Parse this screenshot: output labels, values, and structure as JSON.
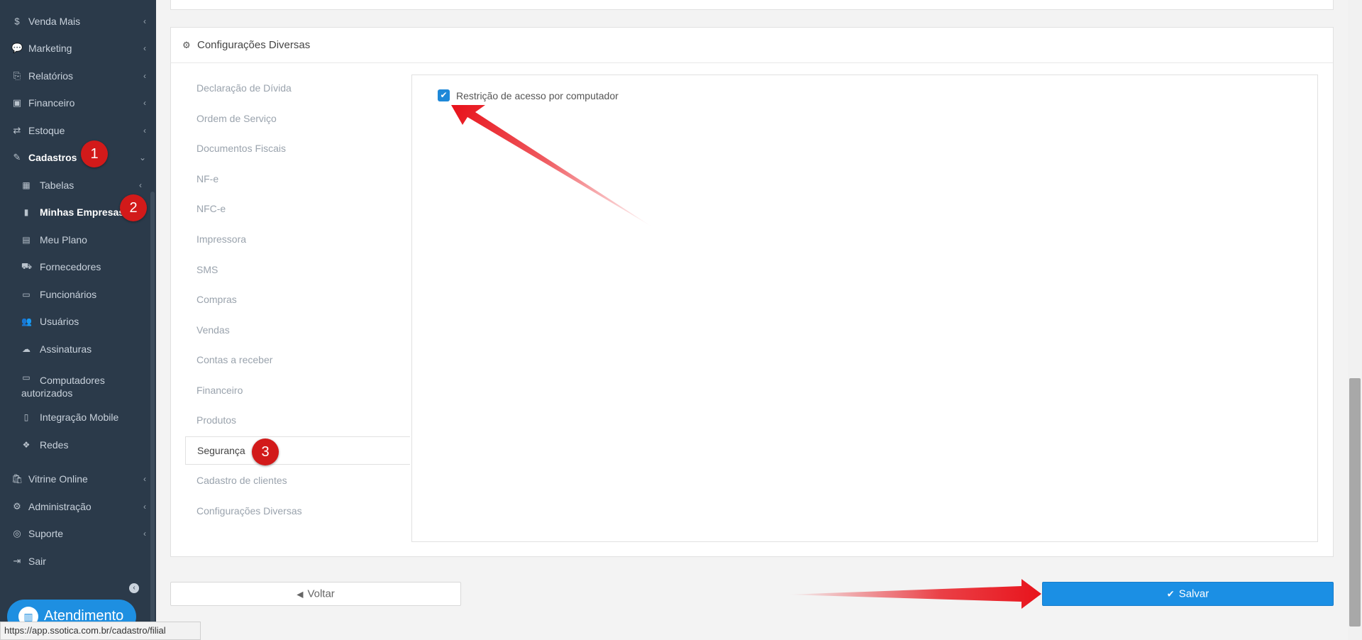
{
  "sidebar": {
    "items": [
      {
        "label": "Venda Mais",
        "icon": "dollar-icon",
        "glyph": "$",
        "chevron": "‹"
      },
      {
        "label": "Marketing",
        "icon": "comments-icon",
        "glyph": "💬",
        "chevron": "‹"
      },
      {
        "label": "Relatórios",
        "icon": "reports-icon",
        "glyph": "⎘",
        "chevron": "‹"
      },
      {
        "label": "Financeiro",
        "icon": "money-icon",
        "glyph": "▣",
        "chevron": "‹"
      },
      {
        "label": "Estoque",
        "icon": "exchange-icon",
        "glyph": "⇄",
        "chevron": "‹"
      },
      {
        "label": "Cadastros",
        "icon": "edit-icon",
        "glyph": "✎",
        "chevron": "⌄"
      }
    ],
    "subitems": [
      {
        "label": "Tabelas",
        "icon": "table-icon",
        "glyph": "▦",
        "chevron": "‹"
      },
      {
        "label": "Minhas Empresas",
        "icon": "building-icon",
        "glyph": "▮"
      },
      {
        "label": "Meu Plano",
        "icon": "file-icon",
        "glyph": "▤"
      },
      {
        "label": "Fornecedores",
        "icon": "truck-icon",
        "glyph": "⛟"
      },
      {
        "label": "Funcionários",
        "icon": "folder-open-icon",
        "glyph": "▭"
      },
      {
        "label": "Usuários",
        "icon": "users-icon",
        "glyph": "👥"
      },
      {
        "label": "Assinaturas",
        "icon": "cloud-icon",
        "glyph": "☁"
      },
      {
        "label": "Computadores autorizados",
        "icon": "desktop-icon",
        "glyph": "▭"
      },
      {
        "label": "Integração Mobile",
        "icon": "mobile-icon",
        "glyph": "▯"
      },
      {
        "label": "Redes",
        "icon": "cubes-icon",
        "glyph": "❖"
      }
    ],
    "bottom_items": [
      {
        "label": "Vitrine Online",
        "icon": "shopping-bag-icon",
        "glyph": "🛍",
        "chevron": "‹"
      },
      {
        "label": "Administração",
        "icon": "cogs-icon",
        "glyph": "⚙",
        "chevron": "‹"
      },
      {
        "label": "Suporte",
        "icon": "life-ring-icon",
        "glyph": "◎",
        "chevron": "‹"
      },
      {
        "label": "Sair",
        "icon": "sign-out-icon",
        "glyph": "⇥"
      }
    ],
    "collapse_glyph": "‹",
    "atendimento": {
      "label": "Atendimento",
      "glyph": "▥"
    }
  },
  "badges": [
    "1",
    "2",
    "3"
  ],
  "panel": {
    "title": "Configurações Diversas",
    "title_glyph": "⚙",
    "tabs": [
      "Declaração de Dívida",
      "Ordem de Serviço",
      "Documentos Fiscais",
      "NF-e",
      "NFC-e",
      "Impressora",
      "SMS",
      "Compras",
      "Vendas",
      "Contas a receber",
      "Financeiro",
      "Produtos",
      "Segurança",
      "Cadastro de clientes",
      "Configurações Diversas"
    ],
    "active_tab": "Segurança",
    "checkbox": {
      "label": "Restrição de acesso por computador",
      "checked": true,
      "glyph": "✔"
    }
  },
  "actions": {
    "voltar_label": "Voltar",
    "voltar_glyph": "◀",
    "salvar_label": "Salvar",
    "salvar_glyph": "✔"
  },
  "status_url": "https://app.ssotica.com.br/cadastro/filial",
  "colors": {
    "sidebar_bg": "#2b3a4a",
    "accent": "#1b8fe4",
    "badge": "#d21a1a",
    "arrow": "#e8131b"
  }
}
